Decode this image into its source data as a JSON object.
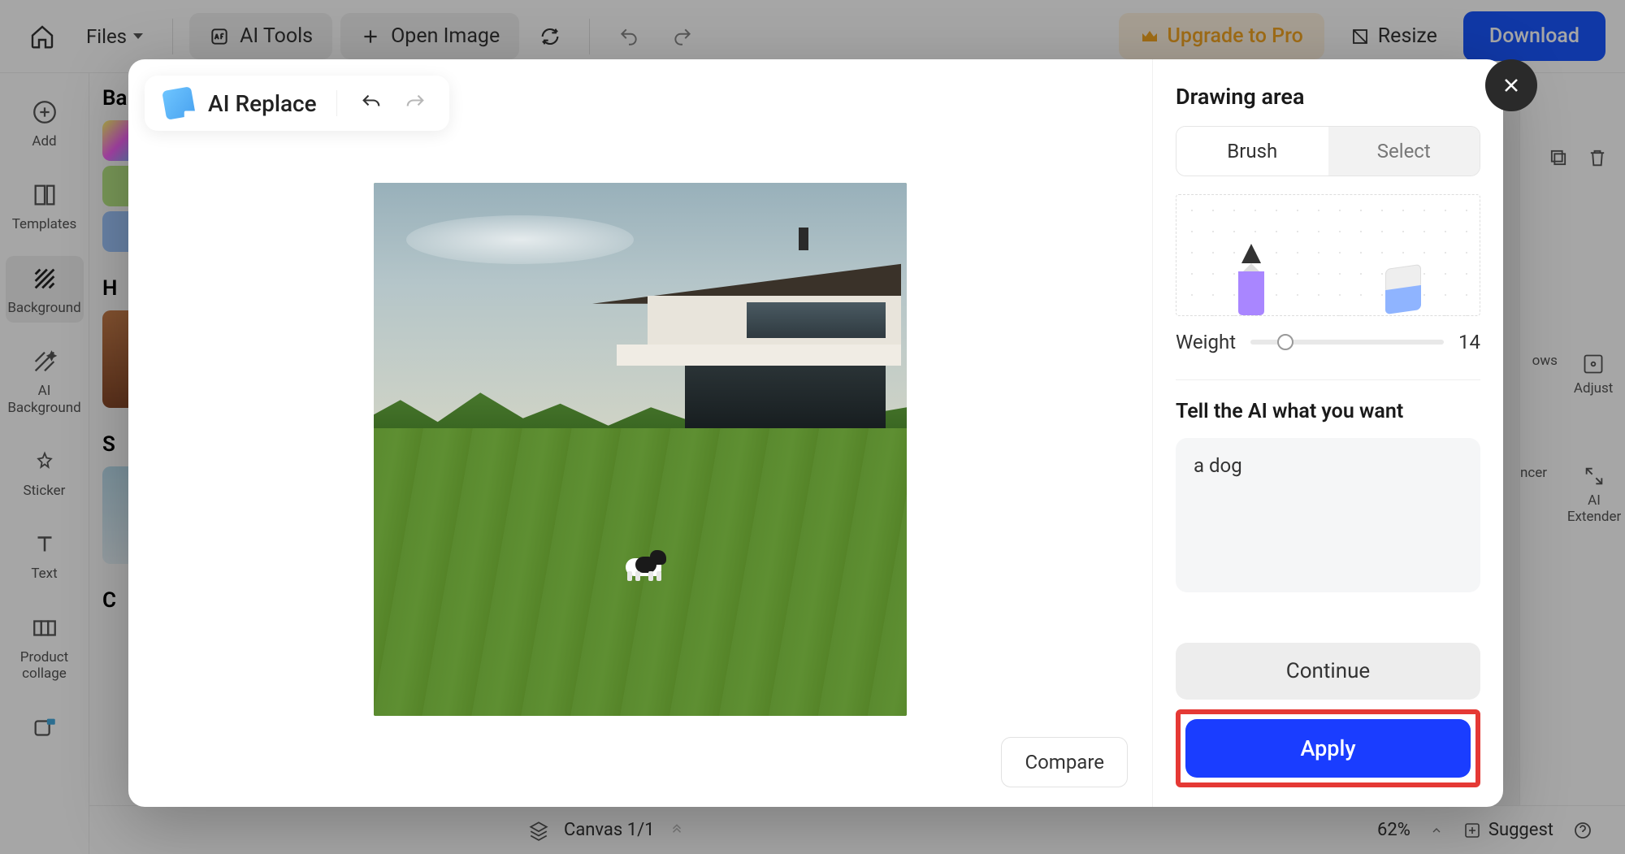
{
  "topbar": {
    "files": "Files",
    "ai_tools": "AI Tools",
    "open_image": "Open Image",
    "upgrade": "Upgrade to Pro",
    "resize": "Resize",
    "download": "Download"
  },
  "left_rail": {
    "items": [
      {
        "label": "Add"
      },
      {
        "label": "Templates"
      },
      {
        "label": "Background"
      },
      {
        "label": "AI Background"
      },
      {
        "label": "Sticker"
      },
      {
        "label": "Text"
      },
      {
        "label": "Product collage"
      }
    ]
  },
  "left_panel": {
    "heading_1": "Ba",
    "heading_2": "H",
    "heading_3": "S",
    "heading_4": "C"
  },
  "bottombar": {
    "canvas": "Canvas 1/1",
    "zoom": "62%",
    "suggest": "Suggest"
  },
  "right_tools": {
    "item_1a": "ows",
    "item_1b": "Adjust",
    "item_2a": "ncer",
    "item_2b": "AI Extender"
  },
  "modal": {
    "toolbar_title": "AI Replace",
    "compare": "Compare",
    "right": {
      "drawing_area": "Drawing area",
      "brush": "Brush",
      "select": "Select",
      "weight_label": "Weight",
      "weight_value": "14",
      "prompt_label": "Tell the AI what you want",
      "prompt_value": "a dog",
      "continue": "Continue",
      "apply": "Apply"
    }
  }
}
